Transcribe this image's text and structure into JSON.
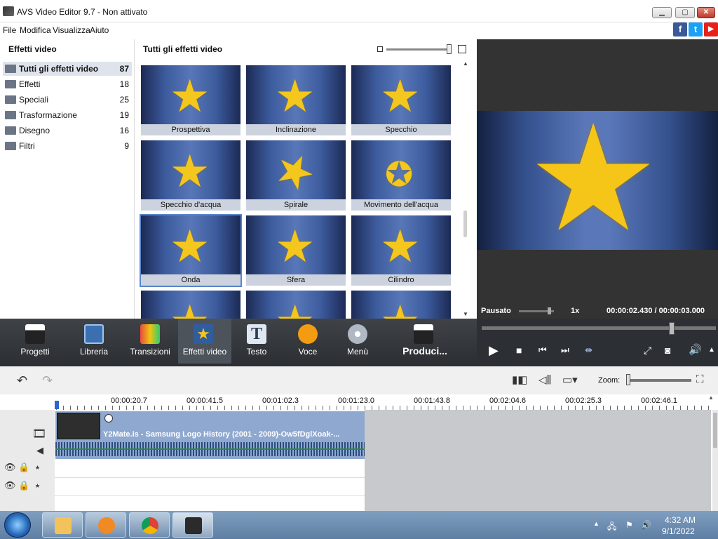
{
  "window": {
    "title": "AVS Video Editor 9.7 - Non attivato"
  },
  "menu": {
    "items": [
      "File",
      "Modifica",
      "Visualizza",
      "Aiuto"
    ]
  },
  "social": {
    "facebook": "f",
    "twitter": "t",
    "youtube": "▶"
  },
  "left_panel": {
    "header": "Effetti video",
    "categories": [
      {
        "label": "Tutti gli effetti video",
        "count": "87",
        "selected": true
      },
      {
        "label": "Effetti",
        "count": "18"
      },
      {
        "label": "Speciali",
        "count": "25"
      },
      {
        "label": "Trasformazione",
        "count": "19"
      },
      {
        "label": "Disegno",
        "count": "16"
      },
      {
        "label": "Filtri",
        "count": "9"
      }
    ]
  },
  "effects_panel": {
    "header": "Tutti gli effetti video",
    "effects": [
      {
        "label": "Prospettiva"
      },
      {
        "label": "Inclinazione"
      },
      {
        "label": "Specchio"
      },
      {
        "label": "Specchio d'acqua"
      },
      {
        "label": "Spirale"
      },
      {
        "label": "Movimento dell'acqua"
      },
      {
        "label": "Onda",
        "selected": true
      },
      {
        "label": "Sfera"
      },
      {
        "label": "Cilindro"
      }
    ]
  },
  "preview": {
    "status": "Pausato",
    "speed": "1x",
    "time": "00:00:02.430 / 00:00:03.000"
  },
  "toolbar": {
    "items": [
      {
        "label": "Progetti",
        "icon": "clapperboard-icon"
      },
      {
        "label": "Libreria",
        "icon": "film-icon"
      },
      {
        "label": "Transizioni",
        "icon": "transition-icon"
      },
      {
        "label": "Effetti video",
        "icon": "star-effect-icon",
        "selected": true
      },
      {
        "label": "Testo",
        "icon": "text-icon"
      },
      {
        "label": "Voce",
        "icon": "microphone-icon"
      },
      {
        "label": "Menù",
        "icon": "disc-menu-icon"
      },
      {
        "label": "Produci...",
        "icon": "produce-icon"
      }
    ]
  },
  "timeline": {
    "zoom_label": "Zoom:",
    "ruler": [
      "00:00:20.7",
      "00:00:41.5",
      "00:01:02.3",
      "00:01:23.0",
      "00:01:43.8",
      "00:02:04.6",
      "00:02:25.3",
      "00:02:46.1"
    ],
    "clip_title": "Y2Mate.is - Samsung Logo History (2001 - 2009)-Ow5fDglXoak-..."
  },
  "taskbar": {
    "time": "4:32 AM",
    "date": "9/1/2022"
  },
  "colors": {
    "accent": "#5a86c9",
    "toolbar_bg": "#2c2f33",
    "star": "#f5c518"
  }
}
